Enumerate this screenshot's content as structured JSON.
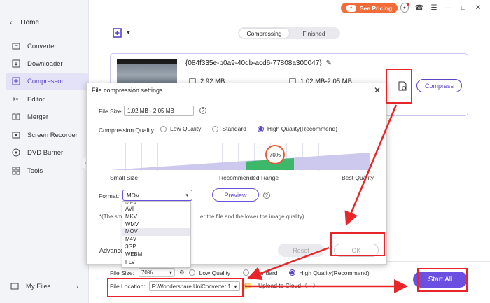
{
  "topbar": {
    "pricing_label": "See Pricing"
  },
  "sidebar": {
    "home_label": "Home",
    "items": [
      {
        "label": "Converter",
        "icon": "converter-icon"
      },
      {
        "label": "Downloader",
        "icon": "download-icon"
      },
      {
        "label": "Compressor",
        "icon": "compress-icon",
        "active": true
      },
      {
        "label": "Editor",
        "icon": "scissors-icon"
      },
      {
        "label": "Merger",
        "icon": "merge-icon"
      },
      {
        "label": "Screen Recorder",
        "icon": "record-icon"
      },
      {
        "label": "DVD Burner",
        "icon": "disc-icon"
      },
      {
        "label": "Tools",
        "icon": "grid-icon"
      }
    ],
    "my_files_label": "My Files"
  },
  "tabs": {
    "compressing": "Compressing",
    "finished": "Finished"
  },
  "file": {
    "name": "{084f335e-b0a9-40db-acd6-77808a300047}",
    "original_size": "2.92 MB",
    "target_size": "1.02 MB-2.05 MB",
    "compress_label": "Compress"
  },
  "dialog": {
    "title": "File compression settings",
    "file_size_label": "File Size:",
    "file_size_value": "1.02 MB - 2.05 MB",
    "quality_label": "Compression Quality:",
    "quality_options": [
      "Low Quality",
      "Standard",
      "High Quality(Recommend)"
    ],
    "quality_selected": "High Quality(Recommend)",
    "slider_value": "70%",
    "slider_level": 0.7,
    "scale_labels": {
      "small": "Small Size",
      "recommended": "Recommended Range",
      "best": "Best Quality"
    },
    "format_label": "Format:",
    "format_value": "MOV",
    "preview_label": "Preview",
    "note_start": "*(The sma",
    "note_end": "er the file and the lower the image quality)",
    "advanced_label": "Advance",
    "reset_label": "Reset",
    "ok_label": "OK",
    "format_options": [
      "MP4",
      "AVI",
      "MKV",
      "WMV",
      "MOV",
      "M4V",
      "3GP",
      "WEBM",
      "FLV"
    ],
    "format_option_selected": "MOV"
  },
  "bottom": {
    "file_size_label": "File Size:",
    "file_size_value": "70%",
    "quality_options": [
      "Low Quality",
      "Standard",
      "High Quality(Recommend)"
    ],
    "quality_selected": "High Quality(Recommend)",
    "file_location_label": "File Location:",
    "file_location_value": "F:\\Wondershare UniConverter 1",
    "upload_cloud_label": "Upload to Cloud",
    "start_all_label": "Start All"
  },
  "colors": {
    "accent": "#6a4fe0",
    "highlight_red": "#e8262a",
    "pricing_orange": "#f26c3a",
    "recommended_green": "#3db76a"
  }
}
